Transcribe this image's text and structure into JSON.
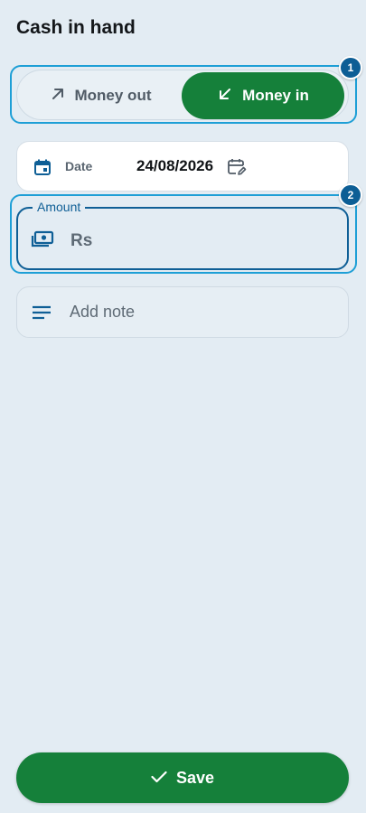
{
  "header": {
    "title": "Cash in hand"
  },
  "toggle": {
    "money_out_label": "Money out",
    "money_in_label": "Money in",
    "selected": "Money in"
  },
  "date_row": {
    "label": "Date",
    "value": "24/08/2026"
  },
  "amount": {
    "legend": "Amount",
    "currency": "Rs",
    "value": ""
  },
  "note": {
    "placeholder": "Add note",
    "value": ""
  },
  "save": {
    "label": "Save"
  },
  "badges": {
    "first": "1",
    "second": "2"
  },
  "colors": {
    "background": "#e3ecf3",
    "accent_green": "#15803a",
    "accent_blue": "#0f5f96",
    "highlight": "#1e9fd6"
  },
  "icons": {
    "money_out": "arrow-up-right-icon",
    "money_in": "arrow-down-left-icon",
    "date": "calendar-icon",
    "date_edit": "calendar-edit-icon",
    "amount": "money-icon",
    "note": "notes-lines-icon",
    "save": "check-icon"
  }
}
